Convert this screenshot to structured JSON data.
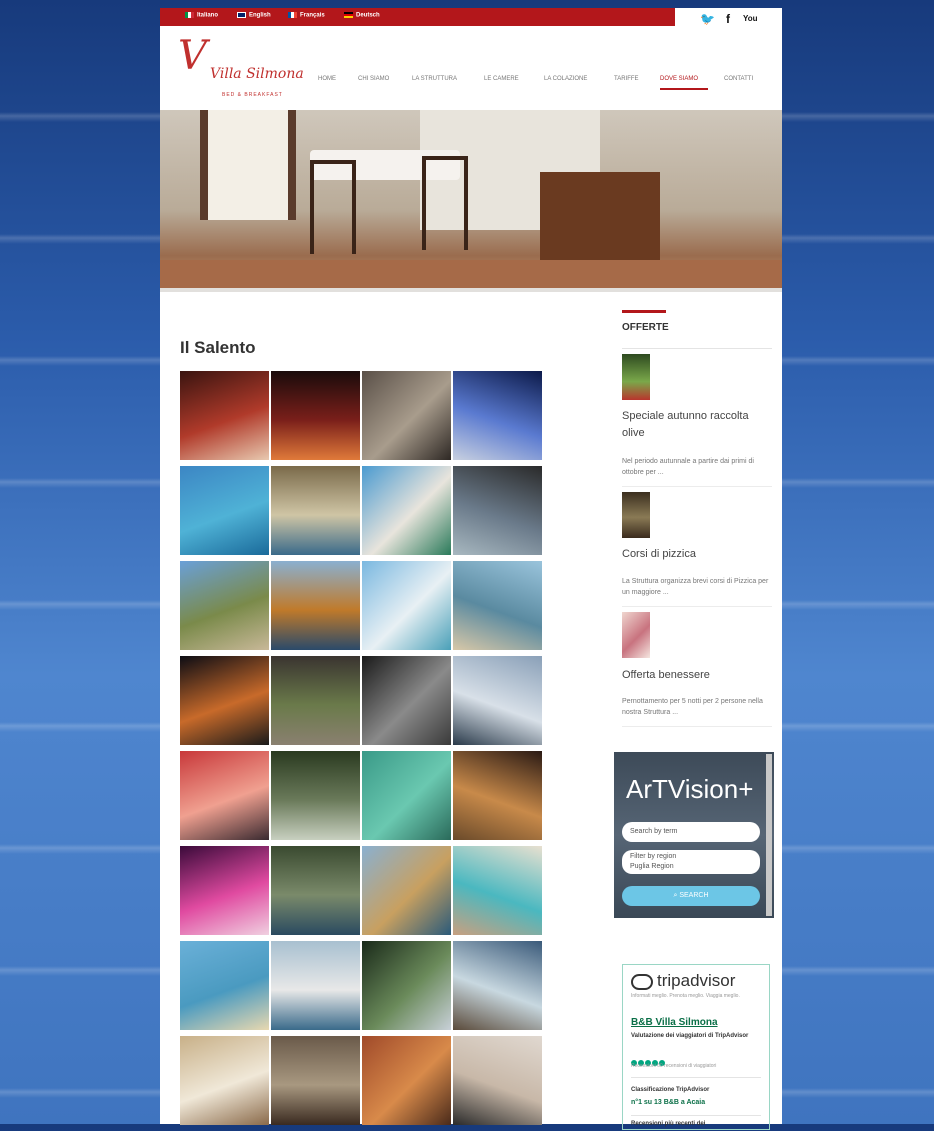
{
  "lang_bar": {
    "languages": [
      {
        "label": "Italiano",
        "flag_colors": [
          "#009246",
          "#ffffff",
          "#ce2b37"
        ]
      },
      {
        "label": "English",
        "flag_colors": [
          "#012169",
          "#ffffff",
          "#c8102e"
        ]
      },
      {
        "label": "Français",
        "flag_colors": [
          "#0055a4",
          "#ffffff",
          "#ef4135"
        ]
      },
      {
        "label": "Deutsch",
        "flag_colors": [
          "#000000",
          "#dd0000",
          "#ffce00"
        ]
      }
    ],
    "social": [
      {
        "icon": "twitter-icon",
        "glyph": "🐦"
      },
      {
        "icon": "facebook-icon",
        "glyph": "f"
      },
      {
        "icon": "youtube-icon",
        "glyph": "You"
      }
    ]
  },
  "logo": {
    "initial": "V",
    "name": "Villa Silmona",
    "tagline": "BED & BREAKFAST"
  },
  "nav": [
    {
      "label": "HOME",
      "active": false
    },
    {
      "label": "CHI SIAMO",
      "active": false
    },
    {
      "label": "LA STRUTTURA",
      "active": false
    },
    {
      "label": "LE CAMERE",
      "active": false
    },
    {
      "label": "LA COLAZIONE",
      "active": false
    },
    {
      "label": "TARIFFE",
      "active": false
    },
    {
      "label": "DOVE SIAMO",
      "active": true
    },
    {
      "label": "CONTATTI",
      "active": false
    }
  ],
  "main": {
    "title": "Il Salento"
  },
  "sidebar": {
    "heading": "OFFERTE",
    "offers": [
      {
        "title": "Speciale autunno raccolta olive",
        "excerpt": "Nel periodo autunnale a partire dai primi di ottobre per ..."
      },
      {
        "title": "Corsi di pizzica",
        "excerpt": "La Struttura organizza brevi corsi di Pizzica per un maggiore ..."
      },
      {
        "title": "Offerta benessere",
        "excerpt": "Pernottamento per 5 notti per 2 persone nella nostra Struttura ..."
      }
    ]
  },
  "artvision": {
    "title": "ArTVision+",
    "search_placeholder": "Search by term",
    "region_label": "Filter by region",
    "region_value": "Puglia Region",
    "search_button": "SEARCH"
  },
  "tripadvisor": {
    "logo": "tripadvisor",
    "tagline": "Informati meglio. Prenota meglio. Viaggia meglio.",
    "name": "B&B Villa Silmona",
    "rating_label": "Valutazione dei viaggiatori di TripAdvisor",
    "rating_count": "Recensioni 60 recensioni di viaggiatori",
    "ranking_label": "Classificazione TripAdvisor",
    "ranking_value": "n°1 su 13 B&B a Acaia",
    "recent_label": "Recensioni più recenti dei"
  },
  "colors": {
    "brand_red": "#b3171b",
    "trip_green": "#00a680"
  }
}
